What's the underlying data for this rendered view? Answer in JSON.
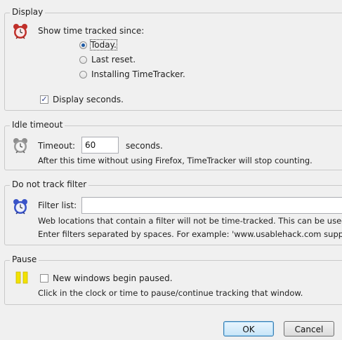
{
  "display": {
    "legend": "Display",
    "show_since_label": "Show time tracked since:",
    "options": [
      {
        "label": "Today.",
        "selected": true
      },
      {
        "label": "Last reset.",
        "selected": false
      },
      {
        "label": "Installing TimeTracker.",
        "selected": false
      }
    ],
    "display_seconds_label": "Display seconds.",
    "display_seconds_checked": true
  },
  "idle": {
    "legend": "Idle timeout",
    "timeout_label": "Timeout:",
    "timeout_value": "60",
    "unit_label": "seconds.",
    "help": "After this time without using Firefox, TimeTracker will stop counting."
  },
  "filter": {
    "legend": "Do not track filter",
    "filter_label": "Filter list:",
    "filter_value": "",
    "help_line1": "Web locations that contain a filter will not be time-tracked. This can be used to av",
    "help_line2": "Enter filters separated by spaces. For example: 'www.usablehack.com support moz"
  },
  "pause": {
    "legend": "Pause",
    "new_windows_label": "New windows begin paused.",
    "new_windows_checked": false,
    "help": "Click in the clock or time to pause/continue tracking that window."
  },
  "buttons": {
    "ok": "OK",
    "cancel": "Cancel"
  },
  "colors": {
    "pause_icon": "#f2e200",
    "alarm_red": "#c0302a",
    "alarm_blue": "#3a54c8"
  },
  "icons": {
    "display": "red-alarm-clock-icon",
    "idle": "gray-alarm-clock-icon",
    "filter": "blue-alarm-clock-icon",
    "pause": "pause-icon"
  }
}
